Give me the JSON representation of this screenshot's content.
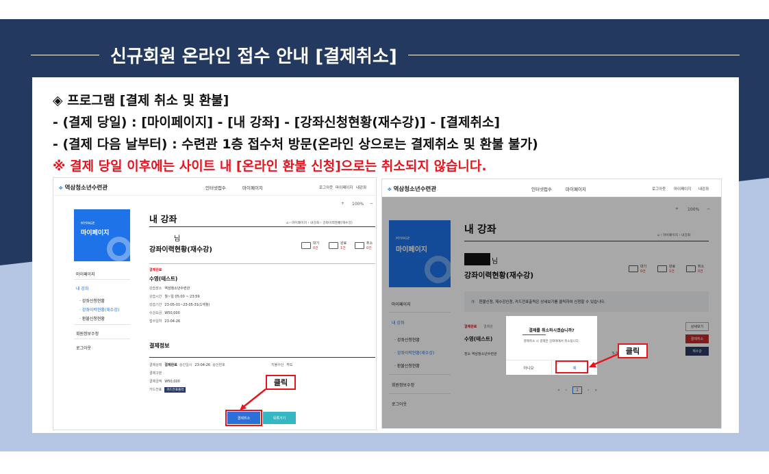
{
  "slide": {
    "title": "신규회원 온라인 접수 안내 [결제취소]",
    "lines": [
      "◈ 프로그램 [결제 취소 및 환불]",
      "-  (결제 당일) : [마이페이지] - [내 강좌] - [강좌신청현황(재수강)] - [결제취소]",
      "-  (결제 다음 날부터) : 수련관 1층 접수처 방문(온라인 상으로는 결제취소 및 환불 불가)",
      "※ 결제 당일 이후에는 사이트 내 [온라인 환불 신청]으로는 취소되지 않습니다."
    ]
  },
  "site": {
    "logo": "역삼청소년수련관",
    "nav": [
      "인터넷접수",
      "마이페이지"
    ],
    "util": [
      "로그아웃",
      "마이페이지",
      "내강좌"
    ],
    "mypage_en": "MYPAGE",
    "mypage_ko": "마이페이지",
    "side": {
      "mypage": "마이페이지",
      "my_course": "내 강좌",
      "sub1": "· 강좌신청현황",
      "sub2": "· 강좌이력현황(재수강)",
      "sub3": "· 환불신청현황",
      "member": "회원정보수정",
      "logout": "로그아웃"
    },
    "zoom": [
      "+",
      "100%",
      "−"
    ],
    "page_title": "내 강좌",
    "breadcrumb": "⌂ › 마이페이지 › 내강좌 › 강좌이력현황(재수강)",
    "breadcrumb_short": "⌂ › 마이페이지 › 내강좌",
    "nim": "님",
    "section_title": "강좌이력현황(재수강)",
    "stats": [
      {
        "label": "대기",
        "value": "0건"
      },
      {
        "label": "완료",
        "value": "1건"
      },
      {
        "label": "취소",
        "value": "0건"
      }
    ]
  },
  "left": {
    "status": "결제완료",
    "course": "수영(테스트)",
    "details": [
      {
        "label": "강습장소",
        "value": "역삼청소년수련관"
      },
      {
        "label": "강습시간",
        "value": "월~일 05:00 ~ 23:59"
      },
      {
        "label": "강습기간",
        "value": "23-05-01~23-05-31(1개월)"
      },
      {
        "label": "수강요금",
        "value": "W50,000"
      },
      {
        "label": "접수일자",
        "value": "23-04-26"
      }
    ],
    "payment_title": "결제정보",
    "payment": {
      "status_label": "결제상태",
      "status_value": "결제완료",
      "date_label": "승인일시",
      "date_value": "23-04-26",
      "approval_label": "승인번호",
      "method_label": "지불수단",
      "method_value": "카드",
      "type_label": "결제구분",
      "amount_label": "결제금액",
      "amount_value": "W50,000",
      "receipt_label": "카드전표",
      "receipt_btn": "카드전표출력"
    },
    "cancel_btn": "결제취소",
    "list_btn": "목록가기",
    "click": "클릭"
  },
  "right": {
    "info": "환불신청, 재수강신청, 카드전표출력은 상세보기를 클릭하여 신청할 수 있습니다.",
    "status": "결제완료",
    "status_hidden": "결제완",
    "course": "수영(테스트)",
    "place": "장소  역삼청소년수련관",
    "date_fragment": "5-31",
    "buttons": [
      "상세보기",
      "결제취소",
      "재수강"
    ],
    "modal_q": "결제를 취소하시겠습니까?",
    "modal_d": "결제취소 시 결제한 강좌에에서 취소됩니다.",
    "modal_no": "아니오",
    "modal_yes": "예",
    "pager": [
      "«",
      "‹",
      "1",
      "›",
      "»"
    ],
    "click": "클릭"
  }
}
